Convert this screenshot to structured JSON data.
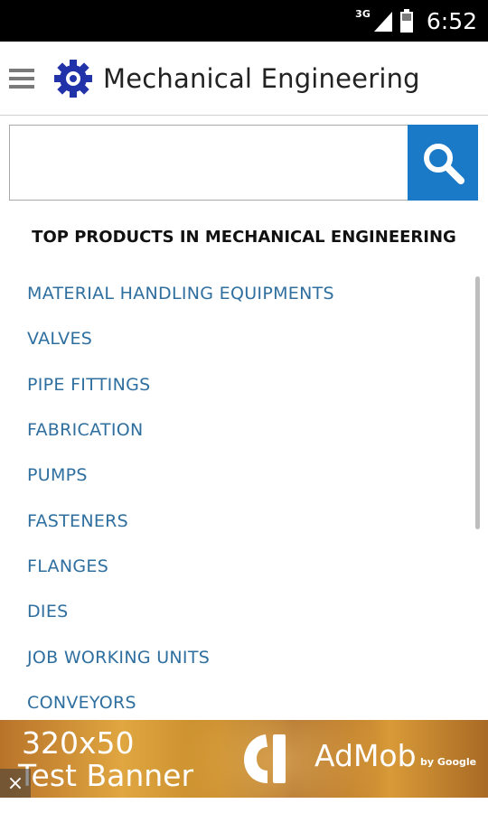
{
  "status_bar": {
    "network_type": "3G",
    "time": "6:52"
  },
  "app_bar": {
    "title": "Mechanical Engineering",
    "menu_icon": "hamburger-menu-icon",
    "logo_icon": "gear-icon"
  },
  "search": {
    "value": "",
    "placeholder": "",
    "button_icon": "search-icon"
  },
  "section": {
    "heading": "TOP PRODUCTS IN MECHANICAL ENGINEERING"
  },
  "products": [
    {
      "label": "MATERIAL HANDLING EQUIPMENTS"
    },
    {
      "label": "VALVES"
    },
    {
      "label": "PIPE FITTINGS"
    },
    {
      "label": "FABRICATION"
    },
    {
      "label": "PUMPS"
    },
    {
      "label": "FASTENERS"
    },
    {
      "label": "FLANGES"
    },
    {
      "label": "DIES"
    },
    {
      "label": "JOB WORKING UNITS"
    },
    {
      "label": "CONVEYORS"
    }
  ],
  "ad": {
    "size_text": "320x50",
    "label": "Test Banner",
    "brand": "AdMob",
    "brand_by": "by Google",
    "close_icon": "close-icon"
  },
  "colors": {
    "accent": "#1a7ac7",
    "link": "#2f6f9f",
    "logo": "#2233aa"
  }
}
